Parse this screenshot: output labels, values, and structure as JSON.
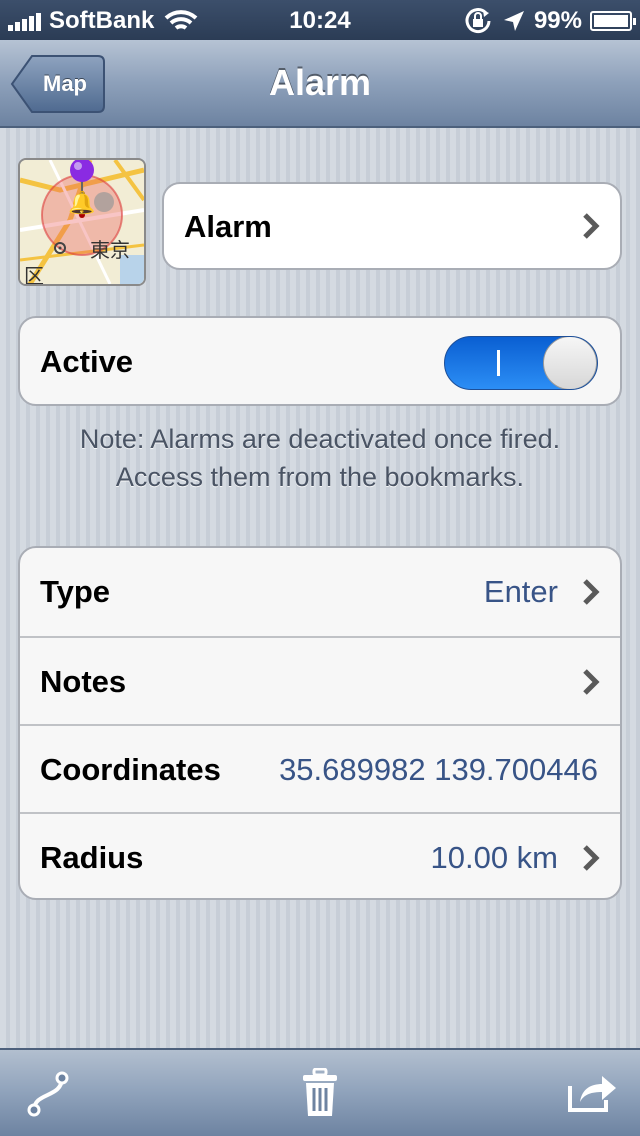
{
  "status_bar": {
    "carrier": "SoftBank",
    "time": "10:24",
    "battery": "99%"
  },
  "nav": {
    "back_label": "Map",
    "title": "Alarm"
  },
  "name_cell": {
    "label": "Alarm"
  },
  "active_cell": {
    "label": "Active",
    "toggle_on": true
  },
  "note": {
    "line1": "Note: Alarms are deactivated once fired.",
    "line2": "Access them from the bookmarks."
  },
  "details": {
    "type": {
      "label": "Type",
      "value": "Enter"
    },
    "notes": {
      "label": "Notes",
      "value": ""
    },
    "coordinates": {
      "label": "Coordinates",
      "value": "35.689982 139.700446"
    },
    "radius": {
      "label": "Radius",
      "value": "10.00 km"
    }
  },
  "thumbnail": {
    "map_text_1": "東京",
    "map_text_2": "区"
  },
  "icons": [
    "route-icon",
    "trash-icon",
    "share-icon",
    "bell-icon",
    "pin-icon"
  ],
  "colors": {
    "nav_top": "#b6c3d4",
    "nav_bottom": "#6d83a1",
    "value_text": "#385487",
    "toggle_blue": "#0a5fd2"
  }
}
